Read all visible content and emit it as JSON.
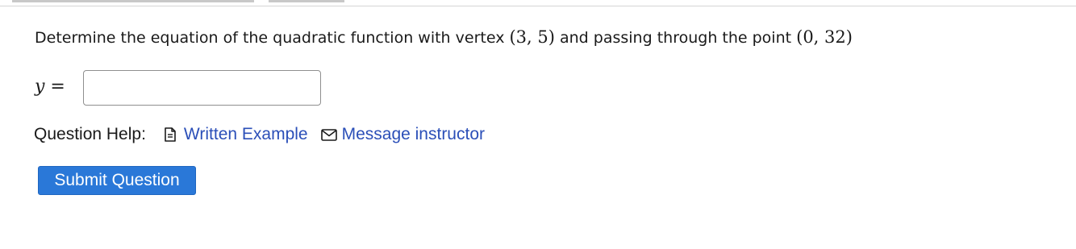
{
  "question": {
    "text_before": "Determine the equation of the quadratic function with vertex ",
    "vertex": "(3, 5)",
    "text_middle": " and passing through the point ",
    "point": "(0, 32)"
  },
  "answer": {
    "variable": "y",
    "equals": " =",
    "value": "",
    "placeholder": ""
  },
  "help": {
    "label": "Question Help:",
    "written_example": "Written Example",
    "message_instructor": "Message instructor"
  },
  "submit": {
    "label": "Submit Question"
  },
  "colors": {
    "link": "#2b4fb8",
    "button": "#2a78d8",
    "button_text": "#ffffff"
  },
  "icons": {
    "written_example": "document-icon",
    "message_instructor": "envelope-icon"
  }
}
